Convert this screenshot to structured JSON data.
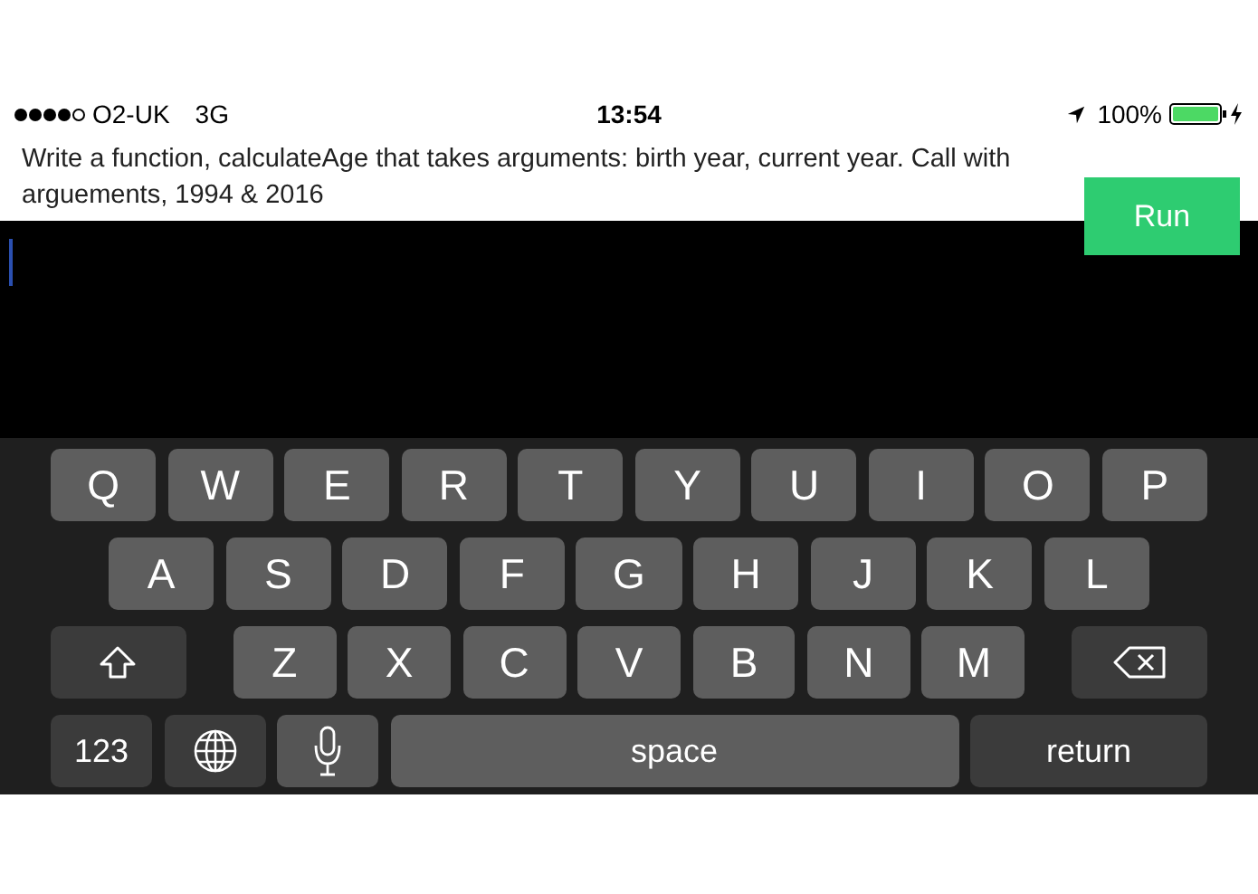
{
  "status_bar": {
    "carrier": "O2-UK",
    "network": "3G",
    "time": "13:54",
    "battery": "100%"
  },
  "prompt": "Write a function, calculateAge that takes arguments: birth year, current year. Call with arguements, 1994 & 2016",
  "run_button": "Run",
  "keyboard": {
    "rows": [
      [
        {
          "kind": "letter",
          "label": "Q"
        },
        {
          "kind": "letter",
          "label": "W"
        },
        {
          "kind": "letter",
          "label": "E"
        },
        {
          "kind": "letter",
          "label": "R"
        },
        {
          "kind": "letter",
          "label": "T"
        },
        {
          "kind": "letter",
          "label": "Y"
        },
        {
          "kind": "letter",
          "label": "U"
        },
        {
          "kind": "letter",
          "label": "I"
        },
        {
          "kind": "letter",
          "label": "O"
        },
        {
          "kind": "letter",
          "label": "P"
        }
      ],
      [
        {
          "kind": "letter",
          "label": "A"
        },
        {
          "kind": "letter",
          "label": "S"
        },
        {
          "kind": "letter",
          "label": "D"
        },
        {
          "kind": "letter",
          "label": "F"
        },
        {
          "kind": "letter",
          "label": "G"
        },
        {
          "kind": "letter",
          "label": "H"
        },
        {
          "kind": "letter",
          "label": "J"
        },
        {
          "kind": "letter",
          "label": "K"
        },
        {
          "kind": "letter",
          "label": "L"
        }
      ],
      [
        {
          "kind": "shift"
        },
        {
          "kind": "letter",
          "label": "Z"
        },
        {
          "kind": "letter",
          "label": "X"
        },
        {
          "kind": "letter",
          "label": "C"
        },
        {
          "kind": "letter",
          "label": "V"
        },
        {
          "kind": "letter",
          "label": "B"
        },
        {
          "kind": "letter",
          "label": "N"
        },
        {
          "kind": "letter",
          "label": "M"
        },
        {
          "kind": "delete"
        }
      ],
      [
        {
          "kind": "numbers",
          "label": "123"
        },
        {
          "kind": "globe"
        },
        {
          "kind": "mic"
        },
        {
          "kind": "space",
          "label": "space"
        },
        {
          "kind": "return",
          "label": "return"
        }
      ]
    ]
  }
}
